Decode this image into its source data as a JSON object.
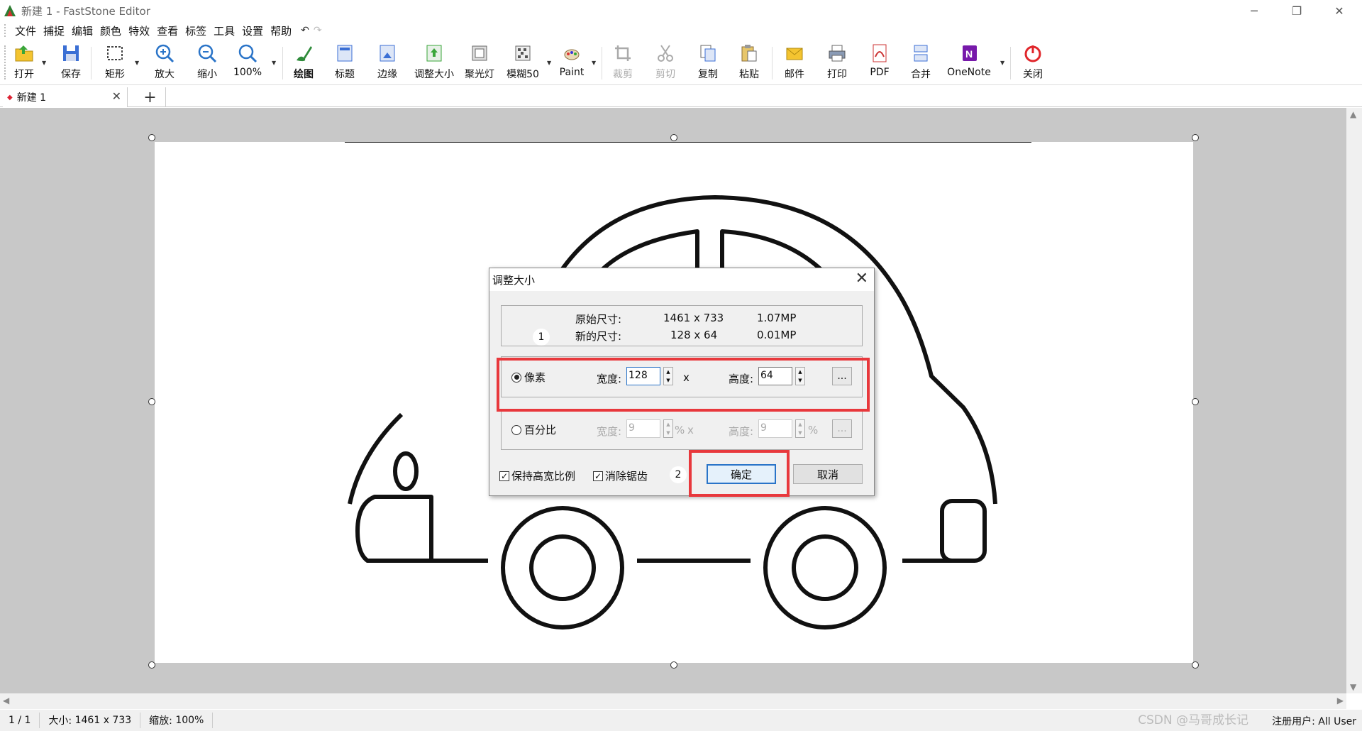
{
  "window": {
    "title": "新建 1 - FastStone Editor",
    "controls": {
      "minimize": "─",
      "restore": "❐",
      "close": "✕"
    }
  },
  "menu": {
    "items": [
      "文件",
      "捕捉",
      "编辑",
      "颜色",
      "特效",
      "查看",
      "标签",
      "工具",
      "设置",
      "帮助"
    ],
    "undo": "↶",
    "redo": "↷"
  },
  "toolbar": {
    "open": "打开",
    "save": "保存",
    "rect": "矩形",
    "zoom_in": "放大",
    "zoom_out": "缩小",
    "zoom_100": "100%",
    "draw": "绘图",
    "caption": "标题",
    "edge": "边缘",
    "resize": "调整大小",
    "spotlight": "聚光灯",
    "blur": "模糊50",
    "paint": "Paint",
    "crop": "裁剪",
    "cut": "剪切",
    "copy": "复制",
    "paste": "粘贴",
    "mail": "邮件",
    "print": "打印",
    "pdf": "PDF",
    "merge": "合并",
    "onenote": "OneNote",
    "close": "关闭"
  },
  "tabs": {
    "active": "新建 1",
    "add": "+"
  },
  "dialog": {
    "title": "调整大小",
    "original_label": "原始尺寸:",
    "original_size": "1461 x 733",
    "original_mp": "1.07MP",
    "new_label": "新的尺寸:",
    "new_size": "128 x 64",
    "new_mp": "0.01MP",
    "pixel_option": "像素",
    "percent_option": "百分比",
    "width_label": "宽度:",
    "height_label": "高度:",
    "times": "x",
    "pixel_width": "128",
    "pixel_height": "64",
    "percent_width": "9",
    "percent_height": "9",
    "percent_unit": "%",
    "more": "...",
    "keep_ratio": "保持高宽比例",
    "antialias": "消除锯齿",
    "ok": "确定",
    "cancel": "取消",
    "step1": "1",
    "step2": "2"
  },
  "status": {
    "page": "1 / 1",
    "size_label": "大小:",
    "size_value": "1461 x 733",
    "zoom_label": "缩放:",
    "zoom_value": "100%",
    "user": "注册用户: All User"
  },
  "watermark": "CSDN @马哥成长记",
  "colors": {
    "highlight": "#e8383c",
    "focus": "#2a74c8",
    "workspace": "#c8c8c8"
  }
}
